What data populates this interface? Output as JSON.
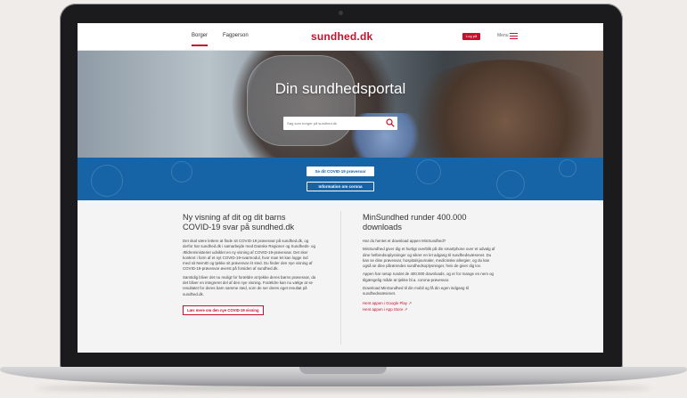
{
  "header": {
    "tabs": [
      {
        "label": "Borger",
        "active": true
      },
      {
        "label": "Fagperson",
        "active": false
      }
    ],
    "logo_text": "sundhed",
    "logo_dot": ".dk",
    "login_label": "Log på",
    "menu_label": "Menu"
  },
  "hero": {
    "title": "Din sundhedsportal",
    "search_placeholder": "Søg som borger på sundhed.dk"
  },
  "band": {
    "button_covid": "Se dit COVID-19 prøvesvar",
    "button_corona": "Information om corona"
  },
  "left_article": {
    "title": "Ny visning af dit og dit barns COVID-19 svar på sundhed.dk",
    "paragraphs": [
      "Det skal være lettere at finde sit COVID-19 prøvesvar på sundhed.dk, og derfor har sundhed.dk i samarbejde med Danske Regioner og Sundheds- og Ældreministeriet udviklet en ny visning af COVID-19-prøvesvar. Det sker konkret i form af et nyt COVID-19-svarmodul, hvor man let kan logge ind med sit NemID og tjekke sit prøvesvar ét sted. Du finder den nye visning af COVID-19-prøvesvar øverst på forsiden af sundhed.dk.",
      "Samtidig bliver det nu muligt for forældre at tjekke deres børns prøvesvar, da det bliver en integreret del af den nye visning. Forældre kan nu vælge at se resultatet for deres barn samme sted, som de ser deres eget resultat på sundhed.dk."
    ],
    "button": "Læs mere om den nye COVID-19 visning"
  },
  "right_article": {
    "title": "MinSundhed runder 400.000 downloads",
    "paragraphs": [
      "Har du hentet et download appen MinSundhed?",
      "MinSundhed giver dig et hurtigt overblik på din smartphone over et udvalg af dine helbredsoplysninger og sikrer en let adgang til sundhedsvæsenet. Du kan se dine prøvesvar, hospitalsjournaler, medicinske allergier, og du kan også se dine pårørendes sundhedsoplysninger, hvis de giver dig lov.",
      "Appen har netop rundet de 400.000 downloads, og er for mange en nem og tilgængelig måde at tjekke bl.a. corona-prøvesvar.",
      "Download MinSundhed til din mobil og få din egen indgang til sundhedsvæsenet."
    ],
    "links": [
      "Hent appen i Google Play",
      "Hent appen i App Store"
    ]
  },
  "colors": {
    "brand_red": "#c8102e",
    "band_blue": "#1664a6"
  },
  "icons": [
    "menu-icon",
    "search-icon",
    "external-link-icon"
  ]
}
